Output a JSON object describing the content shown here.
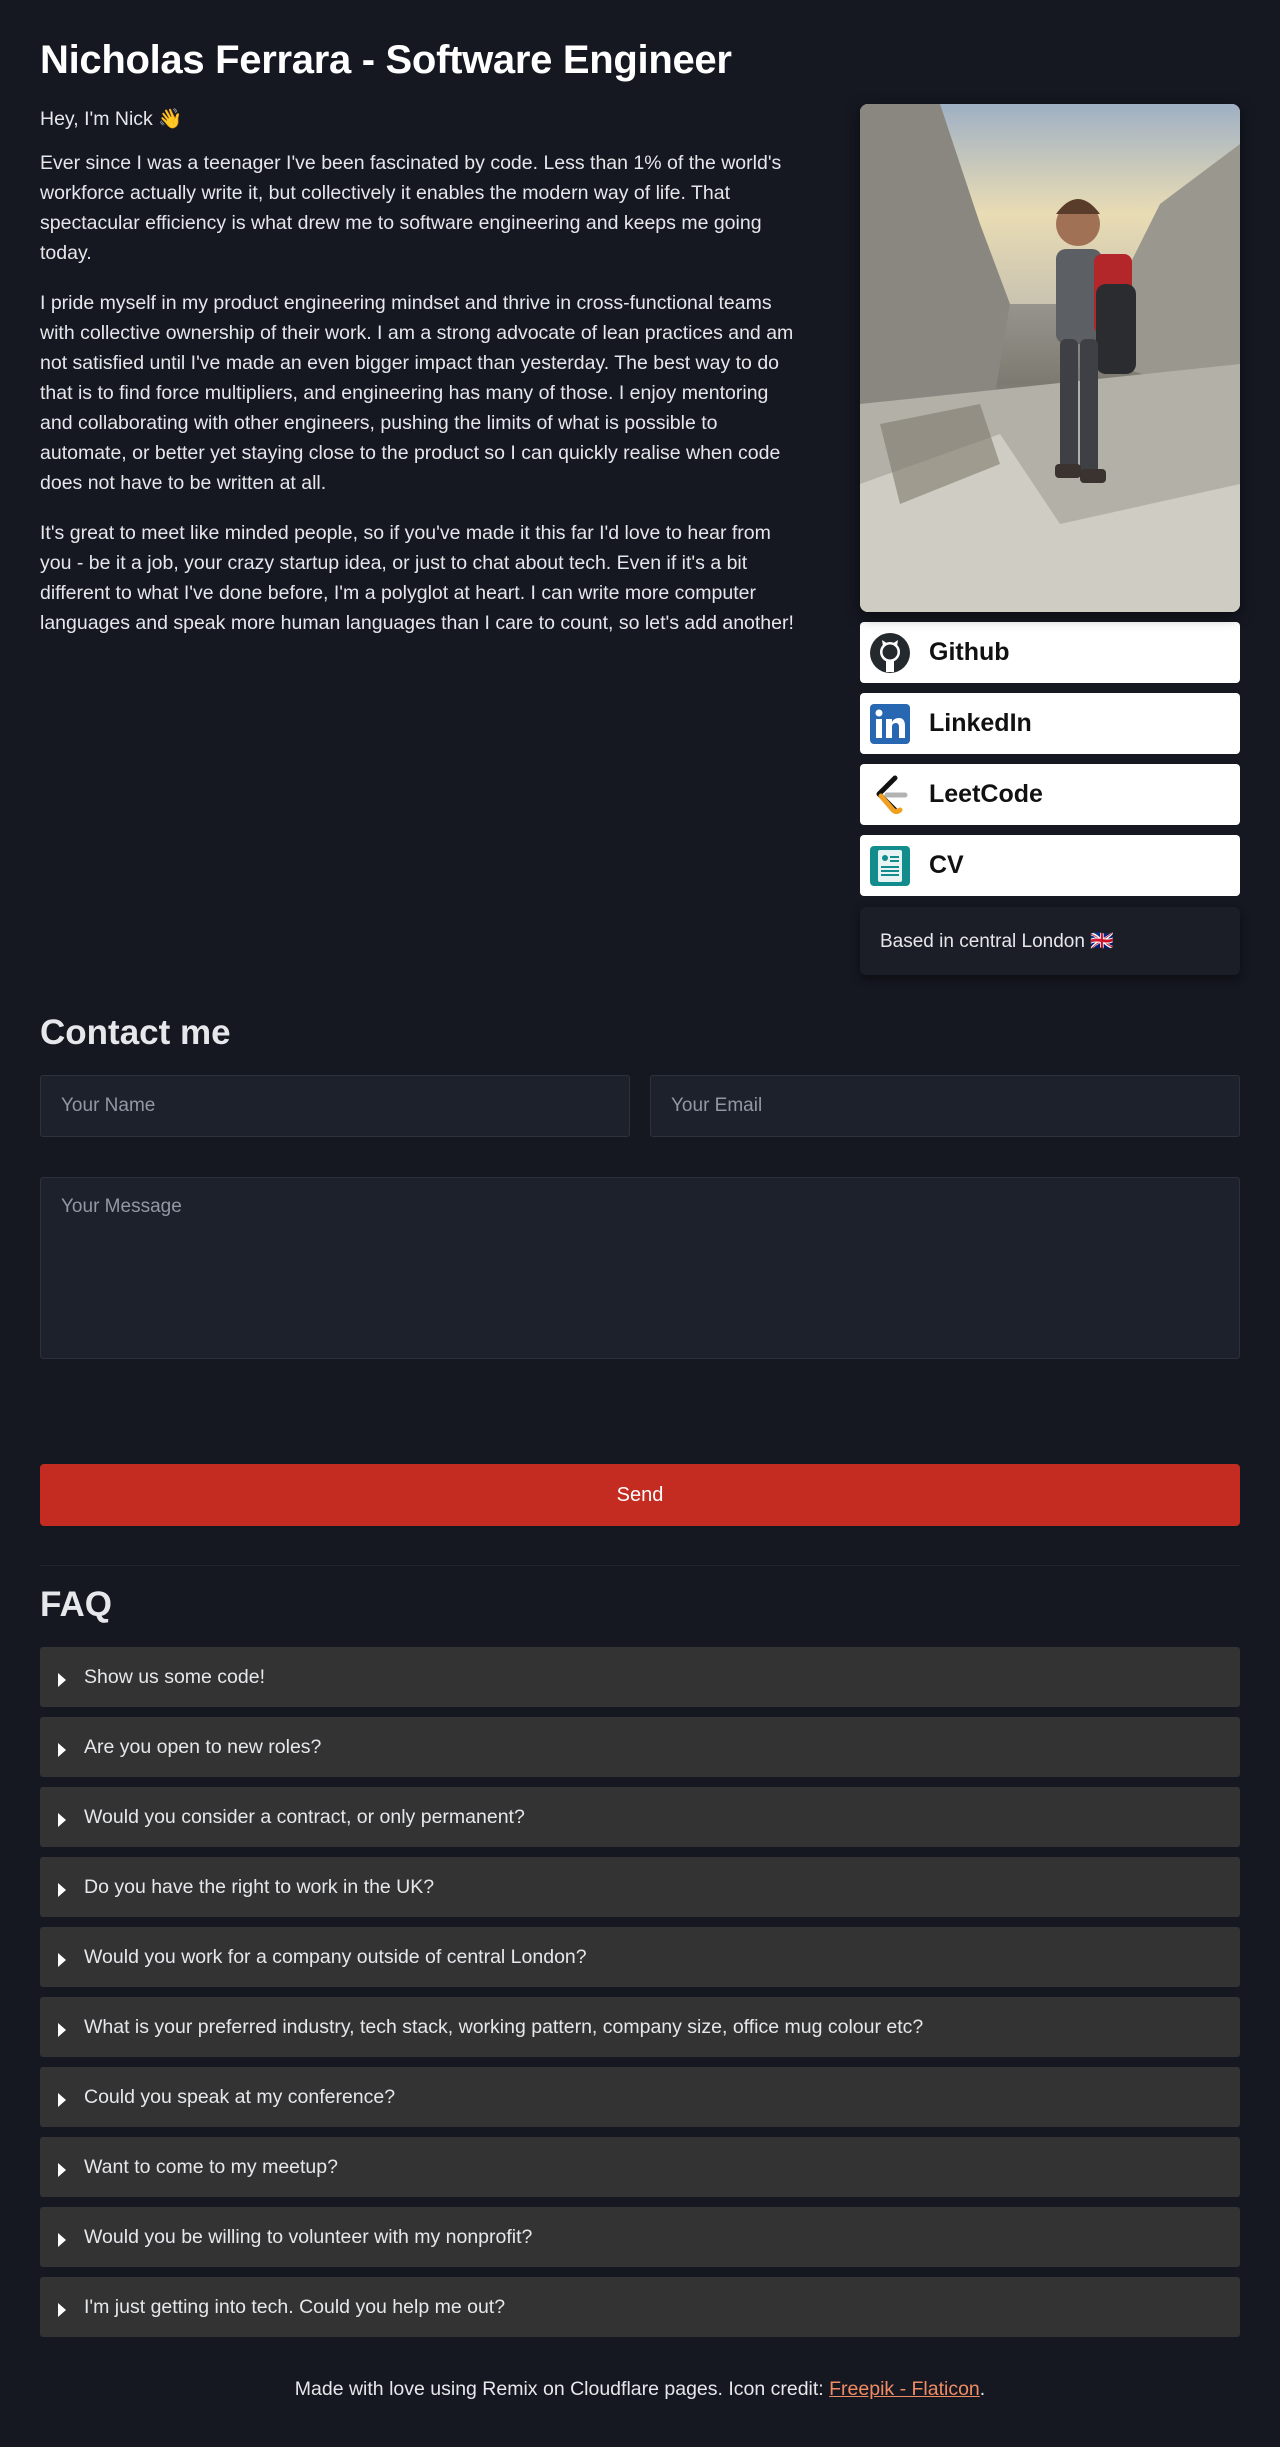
{
  "header": {
    "title": "Nicholas Ferrara - Software Engineer"
  },
  "intro": {
    "greeting": "Hey, I'm Nick 👋",
    "paragraphs": [
      "Ever since I was a teenager I've been fascinated by code. Less than 1% of the world's workforce actually write it, but collectively it enables the modern way of life. That spectacular efficiency is what drew me to software engineering and keeps me going today.",
      "I pride myself in my product engineering mindset and thrive in cross-functional teams with collective ownership of their work. I am a strong advocate of lean practices and am not satisfied until I've made an even bigger impact than yesterday. The best way to do that is to find force multipliers, and engineering has many of those. I enjoy mentoring and collaborating with other engineers, pushing the limits of what is possible to automate, or better yet staying close to the product so I can quickly realise when code does not have to be written at all.",
      "It's great to meet like minded people, so if you've made it this far I'd love to hear from you - be it a job, your crazy startup idea, or just to chat about tech. Even if it's a bit different to what I've done before, I'm a polyglot at heart. I can write more computer languages and speak more human languages than I care to count, so let's add another!"
    ]
  },
  "links": [
    {
      "label": "Github",
      "icon": "github-icon"
    },
    {
      "label": "LinkedIn",
      "icon": "linkedin-icon"
    },
    {
      "label": "LeetCode",
      "icon": "leetcode-icon"
    },
    {
      "label": "CV",
      "icon": "cv-document-icon"
    }
  ],
  "location": "Based in central London 🇬🇧",
  "contact": {
    "title": "Contact me",
    "name_placeholder": "Your Name",
    "email_placeholder": "Your Email",
    "message_placeholder": "Your Message",
    "send_label": "Send"
  },
  "faq": {
    "title": "FAQ",
    "items": [
      "Show us some code!",
      "Are you open to new roles?",
      "Would you consider a contract, or only permanent?",
      "Do you have the right to work in the UK?",
      "Would you work for a company outside of central London?",
      "What is your preferred industry, tech stack, working pattern, company size, office mug colour etc?",
      "Could you speak at my conference?",
      "Want to come to my meetup?",
      "Would you be willing to volunteer with my nonprofit?",
      "I'm just getting into tech. Could you help me out?"
    ]
  },
  "footer": {
    "text": "Made with love using Remix on Cloudflare pages. Icon credit: ",
    "link_text": "Freepik - Flaticon",
    "suffix": "."
  },
  "colors": {
    "accent": "#c42b21",
    "background": "#151821",
    "link": "#f08c63",
    "faq_bg": "#333333"
  }
}
